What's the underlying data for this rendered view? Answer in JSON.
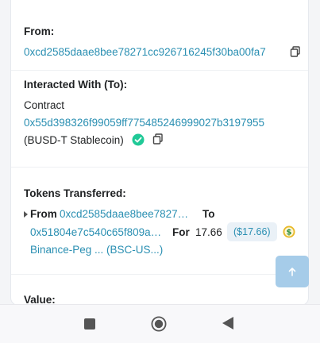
{
  "from_section": {
    "label": "From:",
    "address": "0xcd2585daae8bee78271cc926716245f30ba00fa7"
  },
  "interacted_section": {
    "label": "Interacted With (To):",
    "type_text": "Contract",
    "address": "0x55d398326f99059ff775485246999027b3197955",
    "name": "(BUSD-T Stablecoin)"
  },
  "tokens_section": {
    "label": "Tokens Transferred:",
    "from_label": "From",
    "from_address": "0xcd2585daae8bee7827…",
    "to_label": "To",
    "to_address": "0x51804e7c540c65f809a…",
    "for_label": "For",
    "amount": "17.66",
    "usd_value": "($17.66)",
    "token_name": "Binance-Peg ... (BSC-US...)"
  },
  "value_section": {
    "label": "Value:"
  },
  "colors": {
    "link": "#2a8fb2",
    "verified_check": "#20c997",
    "token_coin": "#e8b928",
    "scroll_button": "#a6cce9"
  },
  "icons": {
    "copy": "copy-icon",
    "verified": "verified-check-icon",
    "coin": "token-coin-icon",
    "scroll_top": "arrow-up-icon",
    "nav_recent": "square-stop-icon",
    "nav_home": "circle-home-icon",
    "nav_back": "triangle-back-icon"
  }
}
